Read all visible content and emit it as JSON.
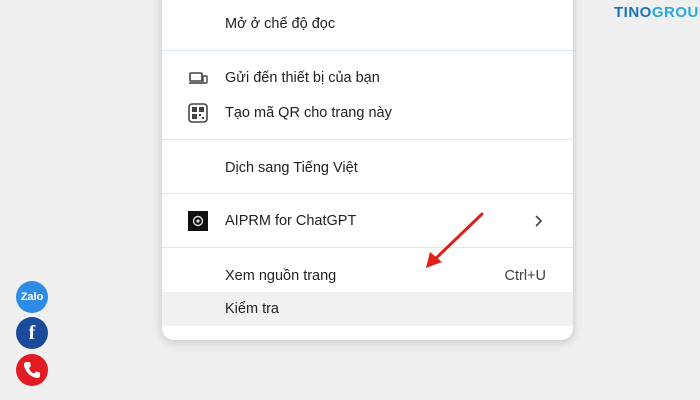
{
  "brand": {
    "part1": "TINO",
    "part2": "GROUP",
    "color1": "#1a73b8",
    "color2": "#29a9d8"
  },
  "menu": {
    "items": [
      {
        "label": "Mở ở chế độ đọc"
      },
      {
        "label": "Gửi đến thiết bị của bạn",
        "icon": "device-send-icon"
      },
      {
        "label": "Tạo mã QR cho trang này",
        "icon": "qr-code-icon"
      },
      {
        "label": "Dịch sang Tiếng Việt"
      },
      {
        "label": "AIPRM for ChatGPT",
        "icon": "aiprm-icon",
        "submenu": true
      },
      {
        "label": "Xem nguồn trang",
        "shortcut": "Ctrl+U"
      },
      {
        "label": "Kiểm tra",
        "highlighted": true
      }
    ]
  },
  "social": {
    "zalo_label": "Zalo",
    "facebook_label": "f",
    "colors": {
      "zalo": "#2e8be6",
      "facebook": "#1a4b9b",
      "phone": "#e11b22"
    }
  },
  "annotation": {
    "arrow_color": "#e0201b"
  }
}
